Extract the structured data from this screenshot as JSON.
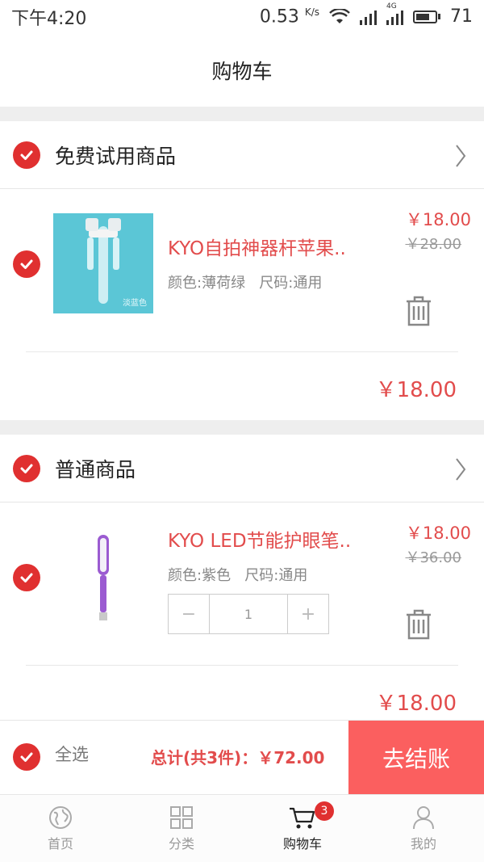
{
  "status_bar": {
    "time": "下午4:20",
    "speed": "0.53",
    "speed_unit": "K/s",
    "network": "4G",
    "battery": "71"
  },
  "header": {
    "title": "购物车"
  },
  "sections": [
    {
      "title": "免费试用商品",
      "item": {
        "name": "KYO自拍神器杆苹果..",
        "color": "颜色:薄荷绿",
        "size": "尺码:通用",
        "price": "￥18.00",
        "old_price": "￥28.00",
        "image_caption": "淡蓝色",
        "subtotal": "￥18.00"
      }
    },
    {
      "title": "普通商品",
      "item": {
        "name": "KYO LED节能护眼笔..",
        "color": "颜色:紫色",
        "size": "尺码:通用",
        "price": "￥18.00",
        "old_price": "￥36.00",
        "quantity": "1",
        "subtotal": "￥18.00"
      }
    }
  ],
  "checkout": {
    "select_all": "全选",
    "total": "总计(共3件)：￥72.00",
    "pay_label": "去结账"
  },
  "tabs": [
    {
      "label": "首页",
      "icon": "globe-icon"
    },
    {
      "label": "分类",
      "icon": "grid-icon"
    },
    {
      "label": "购物车",
      "icon": "cart-icon",
      "badge": "3",
      "active": true
    },
    {
      "label": "我的",
      "icon": "user-icon"
    }
  ],
  "colors": {
    "accent": "#e03030",
    "price": "#e24c4c",
    "pay_button": "#fb5f5f"
  }
}
